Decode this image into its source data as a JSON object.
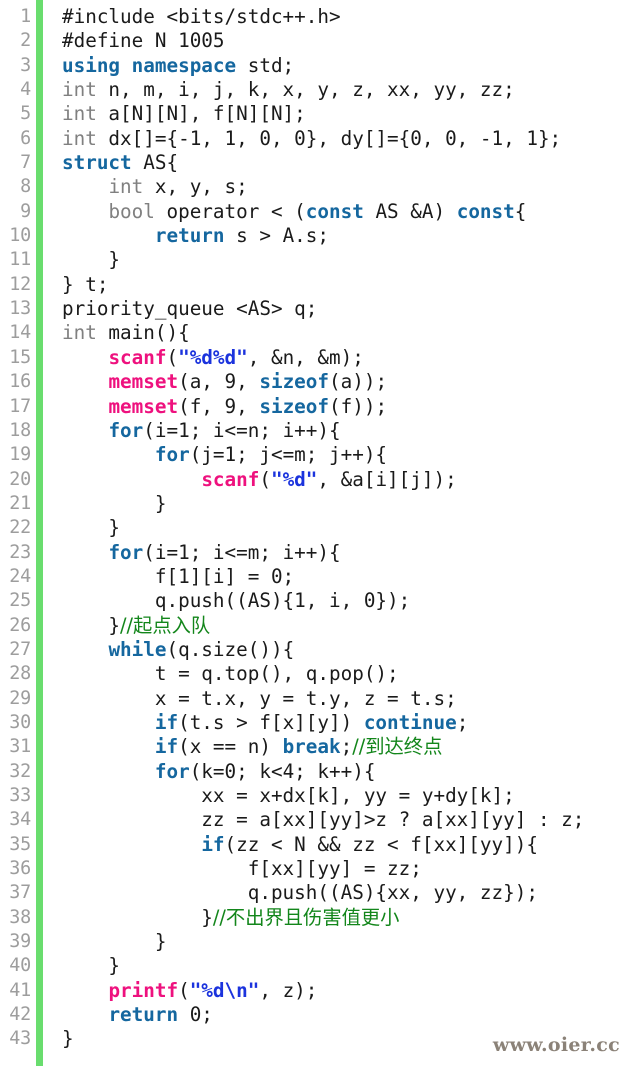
{
  "editor": {
    "language": "C++",
    "background_color": "#ffffff",
    "gutter_bar_color": "#69dd6e",
    "line_number_color": "#9d9d9d",
    "first_line_number": 1,
    "last_line_number": 43,
    "total_lines": 43
  },
  "theme": {
    "keyword_color": "#15679f",
    "type_color": "#808080",
    "function_color": "#ee117e",
    "string_color": "#1b33dd",
    "comment_color": "#13861b",
    "plain_color": "#1a1a1a"
  },
  "watermark": {
    "text": "www.oier.cc",
    "color": "#8b8278"
  },
  "lines": [
    {
      "n": "1",
      "tokens": [
        {
          "t": "p",
          "v": "#include <bits/stdc++.h>"
        }
      ]
    },
    {
      "n": "2",
      "tokens": [
        {
          "t": "p",
          "v": "#define N 1005"
        }
      ]
    },
    {
      "n": "3",
      "tokens": [
        {
          "t": "k",
          "v": "using namespace"
        },
        {
          "t": "p",
          "v": " std;"
        }
      ]
    },
    {
      "n": "4",
      "tokens": [
        {
          "t": "t",
          "v": "int"
        },
        {
          "t": "p",
          "v": " n, m, i, j, k, x, y, z, xx, yy, zz;"
        }
      ]
    },
    {
      "n": "5",
      "tokens": [
        {
          "t": "t",
          "v": "int"
        },
        {
          "t": "p",
          "v": " a[N][N], f[N][N];"
        }
      ]
    },
    {
      "n": "6",
      "tokens": [
        {
          "t": "t",
          "v": "int"
        },
        {
          "t": "p",
          "v": " dx[]={-1, 1, 0, 0}, dy[]={0, 0, -1, 1};"
        }
      ]
    },
    {
      "n": "7",
      "tokens": [
        {
          "t": "k",
          "v": "struct"
        },
        {
          "t": "p",
          "v": " AS{"
        }
      ]
    },
    {
      "n": "8",
      "tokens": [
        {
          "t": "p",
          "v": "    "
        },
        {
          "t": "t",
          "v": "int"
        },
        {
          "t": "p",
          "v": " x, y, s;"
        }
      ]
    },
    {
      "n": "9",
      "tokens": [
        {
          "t": "p",
          "v": "    "
        },
        {
          "t": "t",
          "v": "bool"
        },
        {
          "t": "p",
          "v": " operator < ("
        },
        {
          "t": "k",
          "v": "const"
        },
        {
          "t": "p",
          "v": " AS &A) "
        },
        {
          "t": "k",
          "v": "const"
        },
        {
          "t": "p",
          "v": "{"
        }
      ]
    },
    {
      "n": "10",
      "tokens": [
        {
          "t": "p",
          "v": "        "
        },
        {
          "t": "k",
          "v": "return"
        },
        {
          "t": "p",
          "v": " s > A.s;"
        }
      ]
    },
    {
      "n": "11",
      "tokens": [
        {
          "t": "p",
          "v": "    }"
        }
      ]
    },
    {
      "n": "12",
      "tokens": [
        {
          "t": "p",
          "v": "} t;"
        }
      ]
    },
    {
      "n": "13",
      "tokens": [
        {
          "t": "p",
          "v": "priority_queue <AS> q;"
        }
      ]
    },
    {
      "n": "14",
      "tokens": [
        {
          "t": "t",
          "v": "int"
        },
        {
          "t": "p",
          "v": " main(){"
        }
      ]
    },
    {
      "n": "15",
      "tokens": [
        {
          "t": "p",
          "v": "    "
        },
        {
          "t": "f",
          "v": "scanf"
        },
        {
          "t": "p",
          "v": "("
        },
        {
          "t": "s",
          "v": "\"%d%d\""
        },
        {
          "t": "p",
          "v": ", &n, &m);"
        }
      ]
    },
    {
      "n": "16",
      "tokens": [
        {
          "t": "p",
          "v": "    "
        },
        {
          "t": "f",
          "v": "memset"
        },
        {
          "t": "p",
          "v": "(a, 9, "
        },
        {
          "t": "k",
          "v": "sizeof"
        },
        {
          "t": "p",
          "v": "(a));"
        }
      ]
    },
    {
      "n": "17",
      "tokens": [
        {
          "t": "p",
          "v": "    "
        },
        {
          "t": "f",
          "v": "memset"
        },
        {
          "t": "p",
          "v": "(f, 9, "
        },
        {
          "t": "k",
          "v": "sizeof"
        },
        {
          "t": "p",
          "v": "(f));"
        }
      ]
    },
    {
      "n": "18",
      "tokens": [
        {
          "t": "p",
          "v": "    "
        },
        {
          "t": "k",
          "v": "for"
        },
        {
          "t": "p",
          "v": "(i=1; i<=n; i++){"
        }
      ]
    },
    {
      "n": "19",
      "tokens": [
        {
          "t": "p",
          "v": "        "
        },
        {
          "t": "k",
          "v": "for"
        },
        {
          "t": "p",
          "v": "(j=1; j<=m; j++){"
        }
      ]
    },
    {
      "n": "20",
      "tokens": [
        {
          "t": "p",
          "v": "            "
        },
        {
          "t": "f",
          "v": "scanf"
        },
        {
          "t": "p",
          "v": "("
        },
        {
          "t": "s",
          "v": "\"%d\""
        },
        {
          "t": "p",
          "v": ", &a[i][j]);"
        }
      ]
    },
    {
      "n": "21",
      "tokens": [
        {
          "t": "p",
          "v": "        }"
        }
      ]
    },
    {
      "n": "22",
      "tokens": [
        {
          "t": "p",
          "v": "    }"
        }
      ]
    },
    {
      "n": "23",
      "tokens": [
        {
          "t": "p",
          "v": "    "
        },
        {
          "t": "k",
          "v": "for"
        },
        {
          "t": "p",
          "v": "(i=1; i<=m; i++){"
        }
      ]
    },
    {
      "n": "24",
      "tokens": [
        {
          "t": "p",
          "v": "        f[1][i] = 0;"
        }
      ]
    },
    {
      "n": "25",
      "tokens": [
        {
          "t": "p",
          "v": "        q.push((AS){1, i, 0});"
        }
      ]
    },
    {
      "n": "26",
      "tokens": [
        {
          "t": "p",
          "v": "    }"
        },
        {
          "t": "c",
          "v": "//起点入队"
        }
      ]
    },
    {
      "n": "27",
      "tokens": [
        {
          "t": "p",
          "v": "    "
        },
        {
          "t": "k",
          "v": "while"
        },
        {
          "t": "p",
          "v": "(q.size()){"
        }
      ]
    },
    {
      "n": "28",
      "tokens": [
        {
          "t": "p",
          "v": "        t = q.top(), q.pop();"
        }
      ]
    },
    {
      "n": "29",
      "tokens": [
        {
          "t": "p",
          "v": "        x = t.x, y = t.y, z = t.s;"
        }
      ]
    },
    {
      "n": "30",
      "tokens": [
        {
          "t": "p",
          "v": "        "
        },
        {
          "t": "k",
          "v": "if"
        },
        {
          "t": "p",
          "v": "(t.s > f[x][y]) "
        },
        {
          "t": "k",
          "v": "continue"
        },
        {
          "t": "p",
          "v": ";"
        }
      ]
    },
    {
      "n": "31",
      "tokens": [
        {
          "t": "p",
          "v": "        "
        },
        {
          "t": "k",
          "v": "if"
        },
        {
          "t": "p",
          "v": "(x == n) "
        },
        {
          "t": "k",
          "v": "break"
        },
        {
          "t": "p",
          "v": ";"
        },
        {
          "t": "c",
          "v": "//到达终点"
        }
      ]
    },
    {
      "n": "32",
      "tokens": [
        {
          "t": "p",
          "v": "        "
        },
        {
          "t": "k",
          "v": "for"
        },
        {
          "t": "p",
          "v": "(k=0; k<4; k++){"
        }
      ]
    },
    {
      "n": "33",
      "tokens": [
        {
          "t": "p",
          "v": "            xx = x+dx[k], yy = y+dy[k];"
        }
      ]
    },
    {
      "n": "34",
      "tokens": [
        {
          "t": "p",
          "v": "            zz = a[xx][yy]>z ? a[xx][yy] : z;"
        }
      ]
    },
    {
      "n": "35",
      "tokens": [
        {
          "t": "p",
          "v": "            "
        },
        {
          "t": "k",
          "v": "if"
        },
        {
          "t": "p",
          "v": "(zz < N && zz < f[xx][yy]){"
        }
      ]
    },
    {
      "n": "36",
      "tokens": [
        {
          "t": "p",
          "v": "                f[xx][yy] = zz;"
        }
      ]
    },
    {
      "n": "37",
      "tokens": [
        {
          "t": "p",
          "v": "                q.push((AS){xx, yy, zz});"
        }
      ]
    },
    {
      "n": "38",
      "tokens": [
        {
          "t": "p",
          "v": "            }"
        },
        {
          "t": "c",
          "v": "//不出界且伤害值更小"
        }
      ]
    },
    {
      "n": "39",
      "tokens": [
        {
          "t": "p",
          "v": "        }"
        }
      ]
    },
    {
      "n": "40",
      "tokens": [
        {
          "t": "p",
          "v": "    }"
        }
      ]
    },
    {
      "n": "41",
      "tokens": [
        {
          "t": "p",
          "v": "    "
        },
        {
          "t": "f",
          "v": "printf"
        },
        {
          "t": "p",
          "v": "("
        },
        {
          "t": "s",
          "v": "\"%d\\n\""
        },
        {
          "t": "p",
          "v": ", z);"
        }
      ]
    },
    {
      "n": "42",
      "tokens": [
        {
          "t": "p",
          "v": "    "
        },
        {
          "t": "k",
          "v": "return"
        },
        {
          "t": "p",
          "v": " 0;"
        }
      ]
    },
    {
      "n": "43",
      "tokens": [
        {
          "t": "p",
          "v": "}"
        }
      ]
    }
  ]
}
